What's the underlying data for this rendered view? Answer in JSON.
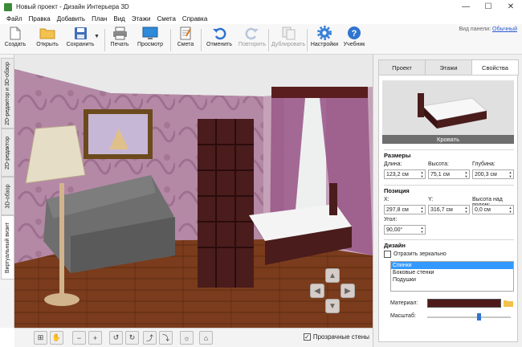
{
  "window": {
    "title": "Новый проект - Дизайн Интерьера 3D",
    "minimize": "—",
    "maximize": "☐",
    "close": "✕"
  },
  "menu": [
    "Файл",
    "Правка",
    "Добавить",
    "План",
    "Вид",
    "Этажи",
    "Смета",
    "Справка"
  ],
  "toolbar": {
    "create": "Создать",
    "open": "Открыть",
    "save": "Сохранить",
    "print": "Печать",
    "preview": "Просмотр",
    "estimate": "Смета",
    "undo": "Отменить",
    "redo": "Повторить",
    "duplicate": "Дублировать",
    "settings": "Настройки",
    "tutorial": "Учебник",
    "panel_view_label": "Вид панели:",
    "panel_view_value": "Обычный"
  },
  "side_tabs": [
    "2D-редактор и 3D-обзор",
    "2D-редактор",
    "3D-обзор",
    "Виртуальный визит"
  ],
  "side_tab_active": "Виртуальный визит",
  "bottom": {
    "transparent_walls_label": "Прозрачные стены",
    "transparent_walls_checked": true
  },
  "panel": {
    "tabs": [
      "Проект",
      "Этажи",
      "Свойства"
    ],
    "active_tab": "Свойства",
    "preview_label": "Кровать",
    "sizes": {
      "header": "Размеры",
      "length_label": "Длина:",
      "length": "123,2 см",
      "height_label": "Высота:",
      "height": "75,1 см",
      "depth_label": "Глубина:",
      "depth": "200,3 см"
    },
    "position": {
      "header": "Позиция",
      "x_label": "X:",
      "x": "297,8 см",
      "y_label": "Y:",
      "y": "316,7 см",
      "elev_label": "Высота над полом:",
      "elev": "0,0 см",
      "angle_label": "Угол:",
      "angle": "90,00°"
    },
    "design": {
      "header": "Дизайн",
      "mirror_label": "Отразить зеркально",
      "mirror_checked": false,
      "items": [
        "Спинки",
        "Боковые стенки",
        "Подушки"
      ],
      "selected": "Спинки",
      "material_label": "Материал:",
      "material_color": "#4e1a1a",
      "scale_label": "Масштаб:",
      "scale": 0.62
    }
  },
  "colors": {
    "accent": "#3399ff",
    "wall": "#b489a6",
    "floor": "#7a3c1c",
    "wood_dark": "#4a1c1c"
  }
}
